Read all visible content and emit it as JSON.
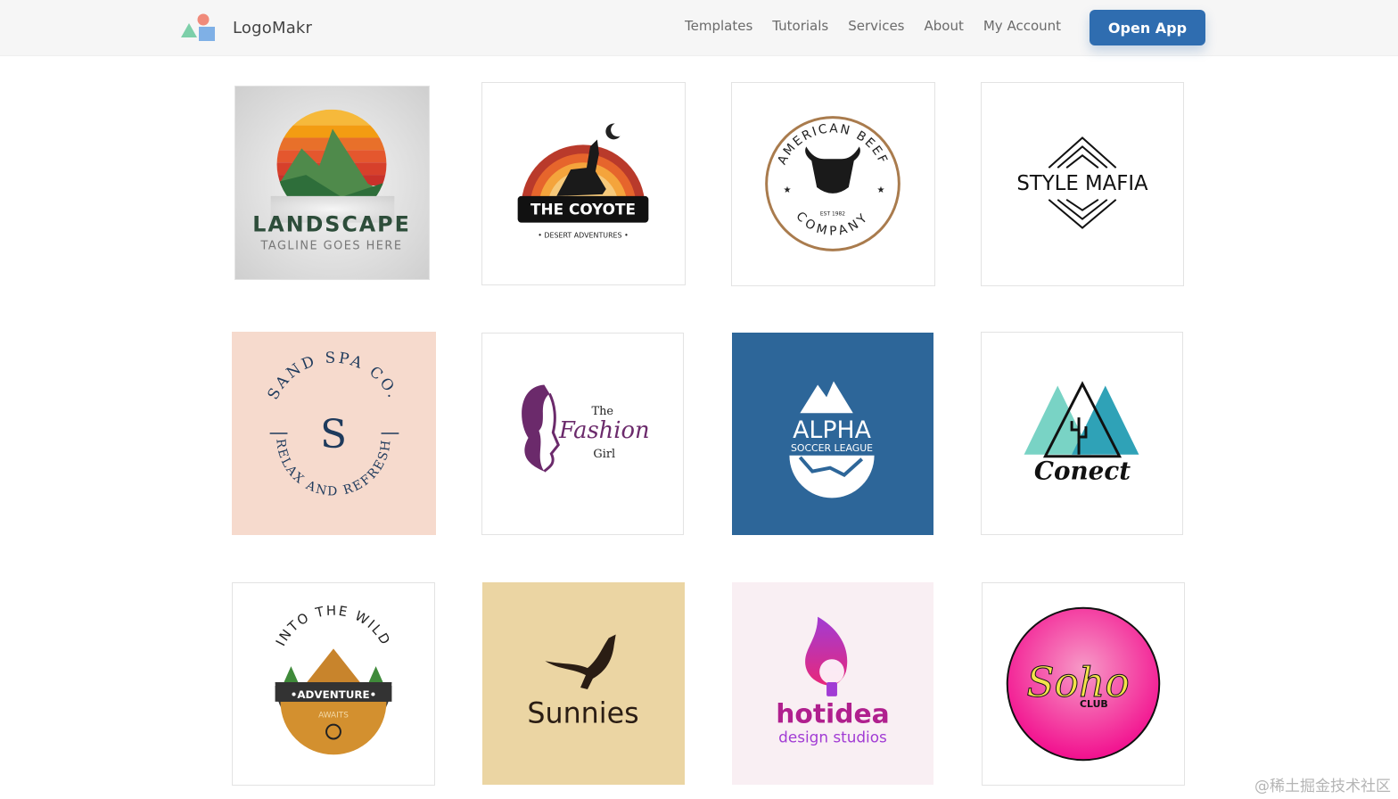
{
  "header": {
    "brand_name": "LogoMakr",
    "nav": [
      "Templates",
      "Tutorials",
      "Services",
      "About",
      "My Account"
    ],
    "cta_label": "Open App",
    "accent_color": "#2f6db0"
  },
  "templates": [
    {
      "title": "LANDSCAPE",
      "tagline": "TAGLINE GOES HERE",
      "icon": "mountain-deer-icon"
    },
    {
      "title": "THE COYOTE",
      "tagline": "• DESERT ADVENTURES •",
      "icon": "howling-coyote-icon"
    },
    {
      "title": "AMERICAN BEEF",
      "tagline": "COMPANY",
      "est": "EST 1982",
      "icon": "bull-head-icon"
    },
    {
      "title": "STYLE MAFIA",
      "icon": "chevron-diamond-icon"
    },
    {
      "title": "SAND SPA CO.",
      "monogram": "S",
      "tagline": "RELAX AND REFRESH",
      "icon": "spa-badge-icon"
    },
    {
      "title_top": "The",
      "title": "Fashion",
      "title_bottom": "Girl",
      "icon": "woman-hair-icon"
    },
    {
      "title": "ALPHA",
      "tagline": "SOCCER LEAGUE",
      "icon": "soccer-ball-icon"
    },
    {
      "title": "Conect",
      "icon": "mountain-cactus-icon"
    },
    {
      "title": "INTO THE WILD",
      "banner": "•ADVENTURE•",
      "tagline": "AWAITS",
      "icon": "camp-tent-icon"
    },
    {
      "title": "Sunnies",
      "icon": "kangaroo-icon"
    },
    {
      "title": "hotidea",
      "tagline": "design studios",
      "icon": "flame-bulb-icon"
    },
    {
      "title": "Soho",
      "tagline": "CLUB",
      "icon": "pink-circle-icon"
    }
  ],
  "watermark": "@稀土掘金技术社区"
}
